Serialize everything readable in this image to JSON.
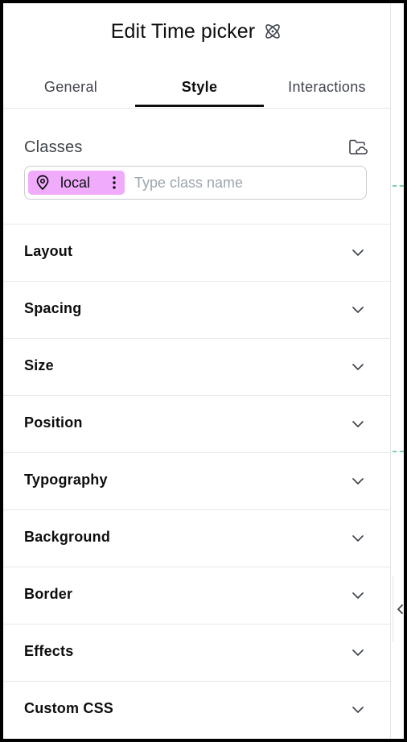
{
  "header": {
    "title": "Edit Time picker",
    "icon": "atom-icon"
  },
  "tabs": [
    {
      "label": "General",
      "active": false
    },
    {
      "label": "Style",
      "active": true
    },
    {
      "label": "Interactions",
      "active": false
    }
  ],
  "classes": {
    "label": "Classes",
    "folder_icon": "folder-cloud-icon",
    "chip": {
      "label": "local",
      "icon": "map-pin-icon",
      "color": "#f0abfc"
    },
    "input_placeholder": "Type class name",
    "input_value": ""
  },
  "sections": [
    {
      "label": "Layout"
    },
    {
      "label": "Spacing"
    },
    {
      "label": "Size"
    },
    {
      "label": "Position"
    },
    {
      "label": "Typography"
    },
    {
      "label": "Background"
    },
    {
      "label": "Border"
    },
    {
      "label": "Effects"
    },
    {
      "label": "Custom CSS"
    }
  ],
  "colors": {
    "accent_chip": "#f0abfc",
    "text": "#0c0d0e",
    "muted": "#3f444b",
    "divider": "#e6e8ea",
    "guide": "#7fd1a3"
  }
}
